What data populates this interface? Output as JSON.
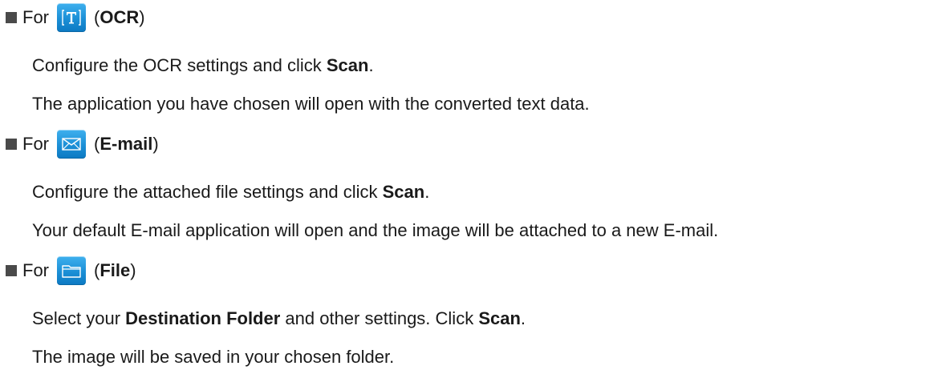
{
  "sections": [
    {
      "for_label": "For",
      "open_paren": "(",
      "name": "OCR",
      "close_paren": ")",
      "icon": "text-ocr-icon",
      "lines": [
        {
          "before": "Configure the OCR settings and click ",
          "bold": "Scan",
          "after": "."
        },
        {
          "text": "The application you have chosen will open with the converted text data."
        }
      ]
    },
    {
      "for_label": "For",
      "open_paren": "(",
      "name": "E-mail",
      "close_paren": ")",
      "icon": "envelope-icon",
      "lines": [
        {
          "before": "Configure the attached file settings and click ",
          "bold": "Scan",
          "after": "."
        },
        {
          "text": "Your default E-mail application will open and the image will be attached to a new E-mail."
        }
      ]
    },
    {
      "for_label": "For",
      "open_paren": "(",
      "name": "File",
      "close_paren": ")",
      "icon": "folder-icon",
      "lines": [
        {
          "before": "Select your ",
          "bold": "Destination Folder",
          "middle": " and other settings. Click ",
          "bold2": "Scan",
          "after": "."
        },
        {
          "text": "The image will be saved in your chosen folder."
        }
      ]
    }
  ]
}
